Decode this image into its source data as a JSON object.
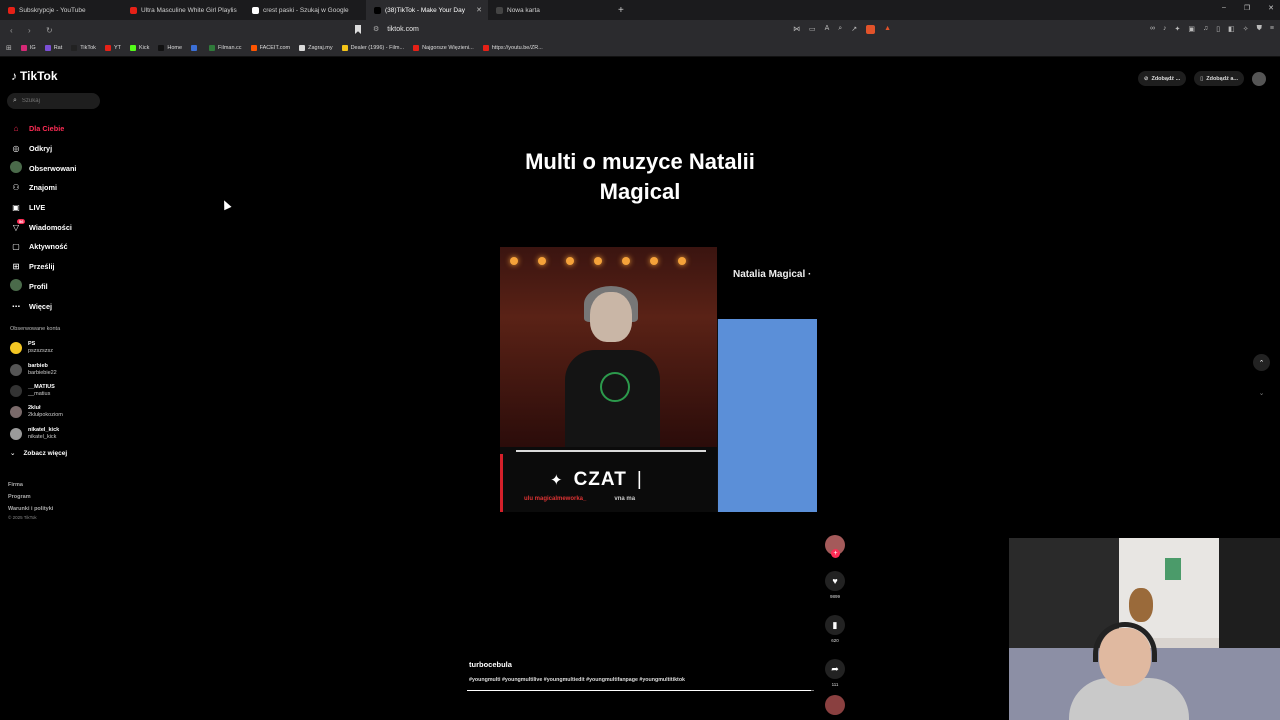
{
  "browser": {
    "tabs": [
      {
        "label": "Subskrypcje - YouTube",
        "favicon_color": "#e62117",
        "active": false
      },
      {
        "label": "Ultra Masculine White Girl Playlis",
        "favicon_color": "#e62117",
        "active": false
      },
      {
        "label": "crest paski - Szukaj w Google",
        "favicon_color": "#ffffff",
        "active": false
      },
      {
        "label": "(38)TikTok - Make Your Day",
        "favicon_color": "#000000",
        "active": true
      },
      {
        "label": "Nowa karta",
        "favicon_color": "#444444",
        "active": false
      }
    ],
    "new_tab_symbol": "+",
    "url": "tiktok.com",
    "bookmarks": [
      {
        "label": "IG",
        "color": "#d62976"
      },
      {
        "label": "Rat",
        "color": "#7b4fd6"
      },
      {
        "label": "TikTok",
        "color": "#222222"
      },
      {
        "label": "YT",
        "color": "#e62117"
      },
      {
        "label": "Kick",
        "color": "#53fc18"
      },
      {
        "label": "Home",
        "color": "#111111"
      },
      {
        "label": "",
        "color": "#3b6fd6"
      },
      {
        "label": "Filman.cc",
        "color": "#2f7a3a"
      },
      {
        "label": "FACEIT.com",
        "color": "#ff5500"
      },
      {
        "label": "Zagraj.my",
        "color": "#d9d9d9"
      },
      {
        "label": "Dealer (1996) - Film...",
        "color": "#f5c518"
      },
      {
        "label": "Najgorsze Więzieni...",
        "color": "#e62117"
      },
      {
        "label": "https://youtu.be/ZR...",
        "color": "#e62117"
      }
    ]
  },
  "tiktok": {
    "logo": "TikTok",
    "search_placeholder": "Szukaj",
    "menu": [
      {
        "label": "Dla Ciebie",
        "icon": "home-icon",
        "glyph": "⌂",
        "active": true
      },
      {
        "label": "Odkryj",
        "icon": "compass-icon",
        "glyph": "◎",
        "active": false
      },
      {
        "label": "Obserwowani",
        "icon": "following-avatar-icon",
        "glyph": "",
        "active": false
      },
      {
        "label": "Znajomi",
        "icon": "friends-icon",
        "glyph": "⚇",
        "active": false
      },
      {
        "label": "LIVE",
        "icon": "live-icon",
        "glyph": "▣",
        "active": false
      },
      {
        "label": "Wiadomości",
        "icon": "messages-icon",
        "glyph": "▽",
        "active": false,
        "badge": "56"
      },
      {
        "label": "Aktywność",
        "icon": "activity-icon",
        "glyph": "▢",
        "active": false
      },
      {
        "label": "Prześlij",
        "icon": "upload-icon",
        "glyph": "⊞",
        "active": false
      },
      {
        "label": "Profil",
        "icon": "profile-icon",
        "glyph": "",
        "active": false
      },
      {
        "label": "Więcej",
        "icon": "more-icon",
        "glyph": "⋯",
        "active": false
      }
    ],
    "followed_title": "Obserwowane konta",
    "followed": [
      {
        "user": "PS",
        "name": "pszszszsz",
        "color": "#f3c623"
      },
      {
        "user": "barbieb",
        "name": "barbiebie22",
        "color": "#555555"
      },
      {
        "user": "__MATIUS",
        "name": "__matius",
        "color": "#333333"
      },
      {
        "user": "2kluł",
        "name": "2klułpokoziom",
        "color": "#7a6a6a"
      },
      {
        "user": "nikatel_kick",
        "name": "nikatel_kick",
        "color": "#9a9a9a"
      }
    ],
    "see_more": "Zobacz więcej",
    "footer_links": [
      "Firma",
      "Program",
      "Warunki i polityki"
    ],
    "copyright": "© 2025 TikTok",
    "topright_pills": [
      "Zdobądź ...",
      "Zdobądź a..."
    ],
    "headline": "Multi o muzyce Natalii Magical",
    "video": {
      "side_title": "Natalia Magical ·",
      "czat": "CZAT",
      "subline_left": "ulu  magicalmeworka_",
      "subline_right": "vna ma"
    },
    "actions": {
      "likes": "9899",
      "saves": "620",
      "shares": "111"
    },
    "caption_user": "turbocebula",
    "caption_tags": "#youngmulti #youngmultilive #youngmultiedit #youngmultifanpage #youngmultitiktok",
    "progress_fraction": 0.99
  }
}
